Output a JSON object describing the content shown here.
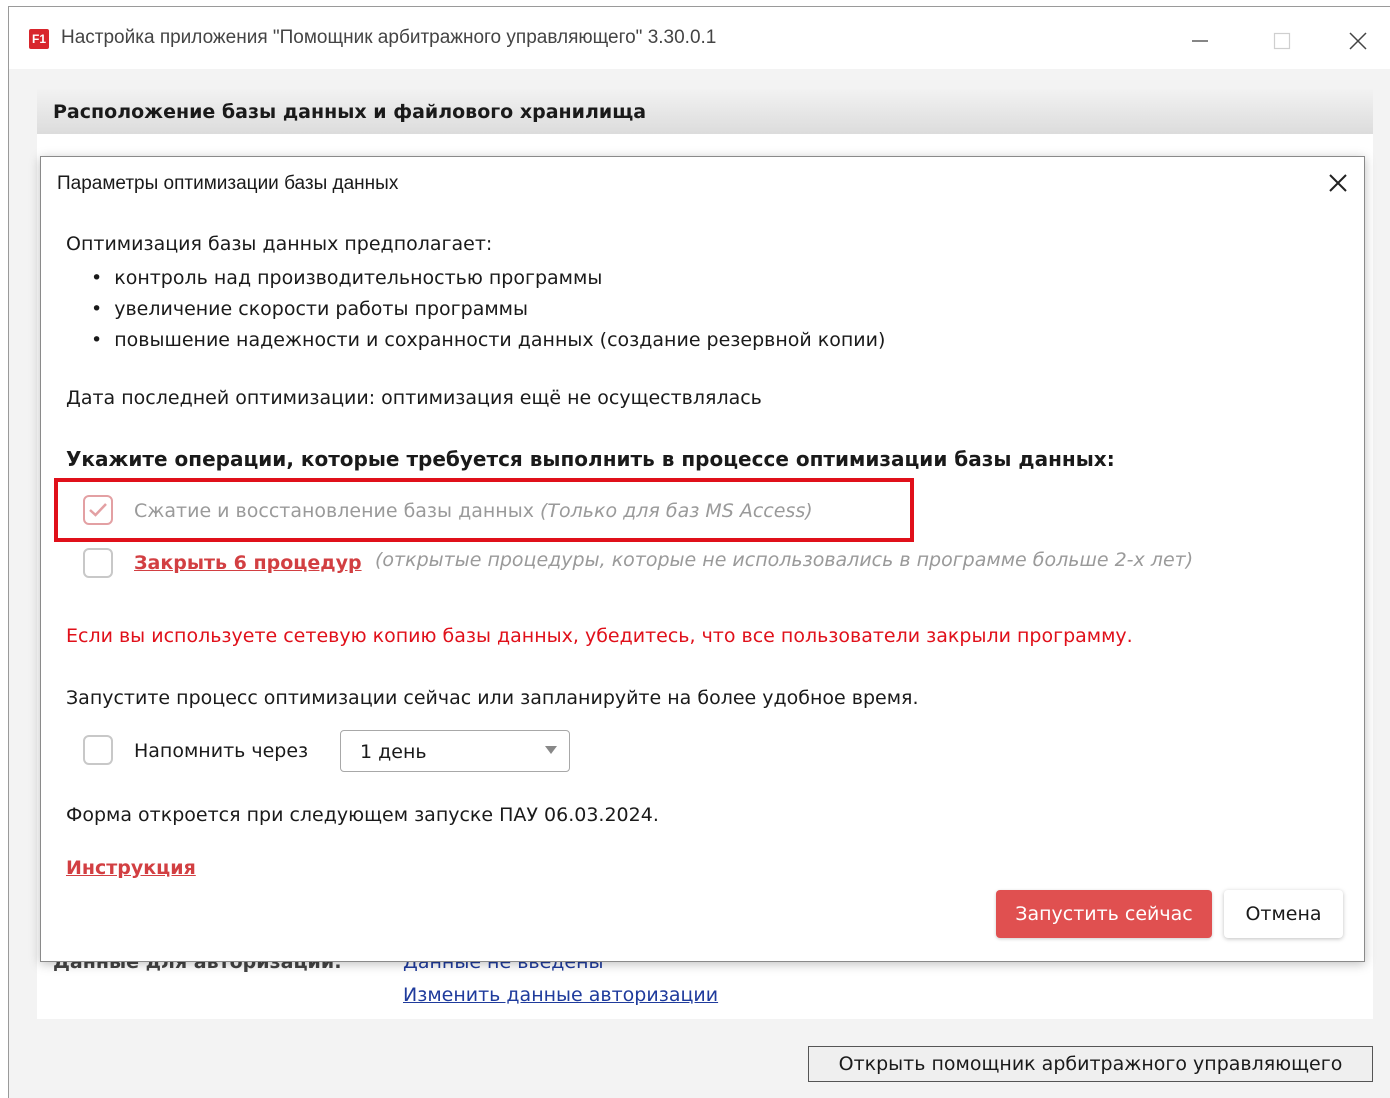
{
  "window": {
    "title": "Настройка приложения \"Помощник арбитражного управляющего\" 3.30.0.1",
    "logo_text": "F1"
  },
  "section": {
    "title": "Расположение базы данных и файлового хранилища",
    "auth_label": "Данные для авторизации:",
    "auth_value": "Данные не введены",
    "auth_change_link": "Изменить данные авторизации"
  },
  "footer": {
    "open_button": "Открыть помощник арбитражного управляющего"
  },
  "dialog": {
    "title": "Параметры оптимизации базы данных",
    "intro": "Оптимизация базы данных предполагает:",
    "bullets": [
      "контроль над производительностью программы",
      "увеличение скорости работы программы",
      "повышение надежности и сохранности данных (создание резервной копии)"
    ],
    "last_optimization": "Дата последней оптимизации: оптимизация ещё не осуществлялась",
    "operations_heading": "Укажите операции, которые требуется выполнить в процессе оптимизации базы данных:",
    "option_compact": {
      "label": "Сжатие и восстановление базы данных",
      "note": "(Только для баз MS Access)",
      "checked": true,
      "disabled": true
    },
    "option_close": {
      "link": "Закрыть 6 процедур",
      "note": "(открытые процедуры, которые не использовались в программе больше 2-х лет)",
      "checked": false
    },
    "warning": "Если вы используете сетевую копию базы данных, убедитесь, что все пользователи закрыли программу.",
    "launch_text": "Запустите процесс оптимизации сейчас или запланируйте на более удобное время.",
    "remind": {
      "label": "Напомнить через",
      "selected": "1 день",
      "checked": false
    },
    "next_launch": "Форма откроется при следующем запуске ПАУ 06.03.2024.",
    "instruction_link": "Инструкция",
    "run_button": "Запустить сейчас",
    "cancel_button": "Отмена"
  },
  "colors": {
    "accent_red": "#e05050",
    "warning_red": "#e0101a",
    "link_blue": "#1f3b9c"
  }
}
